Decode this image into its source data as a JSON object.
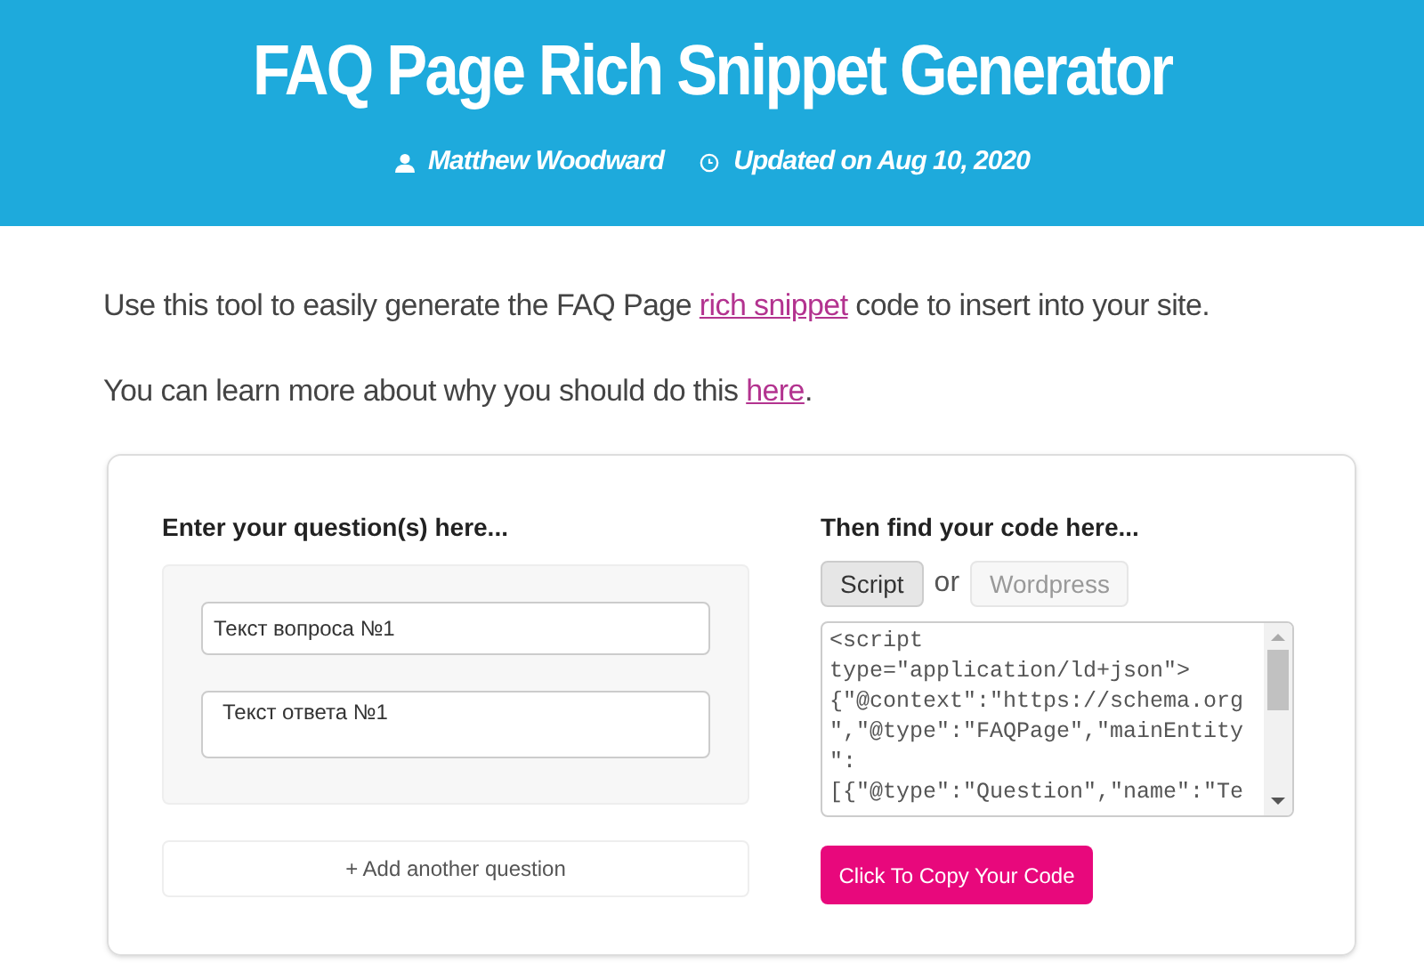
{
  "header": {
    "title": "FAQ Page Rich Snippet Generator",
    "author": "Matthew Woodward",
    "updated": "Updated on Aug 10, 2020"
  },
  "intro": [
    {
      "before": "Use this tool to easily generate the FAQ Page ",
      "link": "rich snippet",
      "after": " code to insert into your site."
    },
    {
      "before": "You can learn more about why you should do this ",
      "link": "here",
      "after": "."
    }
  ],
  "questions_panel": {
    "heading": "Enter your question(s) here...",
    "question_field": {
      "value": "Текст вопроса №1"
    },
    "answer_field": {
      "value": "Текст ответа №1"
    },
    "add_button": "+ Add another question"
  },
  "code_panel": {
    "heading": "Then find your code here...",
    "tabs": [
      {
        "label": "Script",
        "selected": true
      },
      {
        "label": "Wordpress",
        "selected": false
      }
    ],
    "separator": "or",
    "code_lines": [
      "<script",
      "type=\"application/ld+json\">",
      "{\"@context\":\"https://schema.org",
      "\",\"@type\":\"FAQPage\",\"mainEntity",
      "\":",
      "[{\"@type\":\"Question\",\"name\":\"Te"
    ],
    "copy_button": "Click To Copy Your Code"
  }
}
